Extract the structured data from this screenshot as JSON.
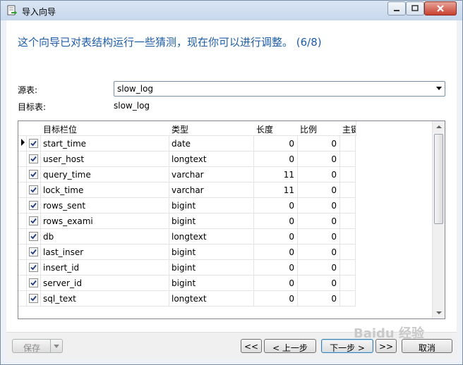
{
  "window": {
    "title": "导入向导",
    "minimize_icon": "minimize-icon",
    "maximize_icon": "maximize-icon",
    "close_icon": "close-icon"
  },
  "heading": "这个向导已对表结构运行一些猜测，现在你可以进行调整。 (6/8)",
  "source_table": {
    "label": "源表:",
    "value": "slow_log"
  },
  "target_table": {
    "label": "目标表:",
    "value": "slow_log"
  },
  "grid": {
    "columns": [
      "目标栏位",
      "类型",
      "长度",
      "比例",
      "主键"
    ],
    "rows": [
      {
        "field": "start_time",
        "type": "date",
        "length": "0",
        "scale": "0",
        "checked": true,
        "current": true
      },
      {
        "field": "user_host",
        "type": "longtext",
        "length": "0",
        "scale": "0",
        "checked": true
      },
      {
        "field": "query_time",
        "type": "varchar",
        "length": "11",
        "scale": "0",
        "checked": true
      },
      {
        "field": "lock_time",
        "type": "varchar",
        "length": "11",
        "scale": "0",
        "checked": true
      },
      {
        "field": "rows_sent",
        "type": "bigint",
        "length": "0",
        "scale": "0",
        "checked": true
      },
      {
        "field": "rows_exami",
        "type": "bigint",
        "length": "0",
        "scale": "0",
        "checked": true
      },
      {
        "field": "db",
        "type": "longtext",
        "length": "0",
        "scale": "0",
        "checked": true
      },
      {
        "field": "last_inser",
        "type": "bigint",
        "length": "0",
        "scale": "0",
        "checked": true
      },
      {
        "field": "insert_id",
        "type": "bigint",
        "length": "0",
        "scale": "0",
        "checked": true
      },
      {
        "field": "server_id",
        "type": "bigint",
        "length": "0",
        "scale": "0",
        "checked": true
      },
      {
        "field": "sql_text",
        "type": "longtext",
        "length": "0",
        "scale": "0",
        "checked": true
      }
    ]
  },
  "footer": {
    "save": "保存",
    "first": "<<",
    "prev": "< 上一步",
    "next": "下一步 >",
    "last": ">>",
    "cancel": "取消"
  },
  "watermark": "Baidu 经验",
  "colors": {
    "heading": "#1e5dab",
    "titlebar": "#c7d7ec",
    "close": "#c8412f"
  }
}
